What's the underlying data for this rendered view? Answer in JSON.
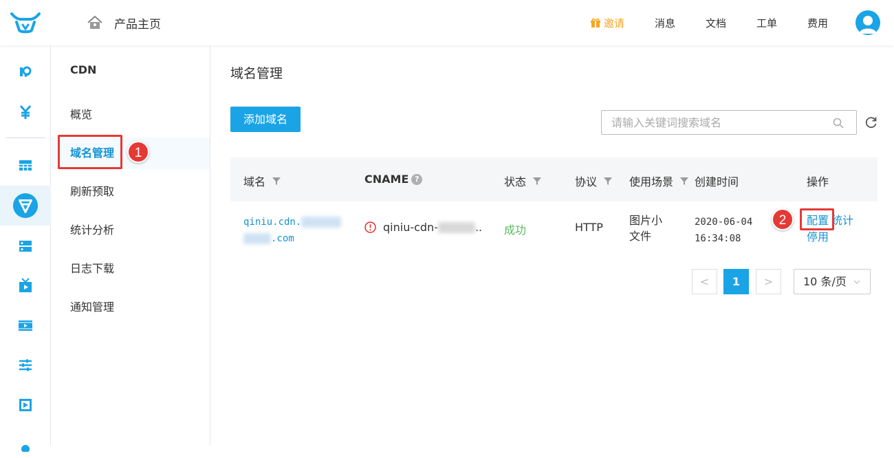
{
  "header": {
    "home_label": "产品主页",
    "nav": [
      {
        "label": "邀请",
        "icon": "gift-icon",
        "color": "#f5a623"
      },
      {
        "label": "消息"
      },
      {
        "label": "文档"
      },
      {
        "label": "工单"
      },
      {
        "label": "费用"
      }
    ]
  },
  "rail": {
    "icons": [
      "qiniu-k-icon",
      "yen-icon",
      "grid-icon",
      "cdn-icon",
      "storage-icon",
      "live-icon",
      "video-icon",
      "settings-sliders-icon",
      "play-icon",
      "more-icon"
    ],
    "active": "cdn-icon"
  },
  "sidebar": {
    "title": "CDN",
    "items": [
      {
        "label": "概览"
      },
      {
        "label": "域名管理",
        "active": true
      },
      {
        "label": "刷新预取"
      },
      {
        "label": "统计分析"
      },
      {
        "label": "日志下载"
      },
      {
        "label": "通知管理"
      }
    ]
  },
  "annotations": {
    "badge1": "1",
    "badge2": "2"
  },
  "main": {
    "title": "域名管理",
    "add_button": "添加域名",
    "search_placeholder": "请输入关键词搜索域名",
    "columns": {
      "domain": "域名",
      "cname": "CNAME",
      "status": "状态",
      "protocol": "协议",
      "scene": "使用场景",
      "created": "创建时间",
      "actions": "操作"
    },
    "rows": [
      {
        "domain_prefix": "qiniu.cdn.",
        "domain_suffix": ".com",
        "cname_prefix": "qiniu-cdn-",
        "cname_ellipsis": "..",
        "status": "成功",
        "protocol": "HTTP",
        "scene_line1": "图片小",
        "scene_line2": "文件",
        "created_date": "2020-06-04",
        "created_time": "16:34:08",
        "action_config": "配置",
        "action_stats": "统计",
        "action_disable": "停用"
      }
    ],
    "pagination": {
      "prev": "<",
      "current": "1",
      "next": ">",
      "page_size": "10 条/页"
    }
  },
  "colors": {
    "accent": "#1aa4e6",
    "link": "#1493d3",
    "success": "#5cb85c",
    "annotation": "#e53935",
    "invite": "#f5a623"
  }
}
